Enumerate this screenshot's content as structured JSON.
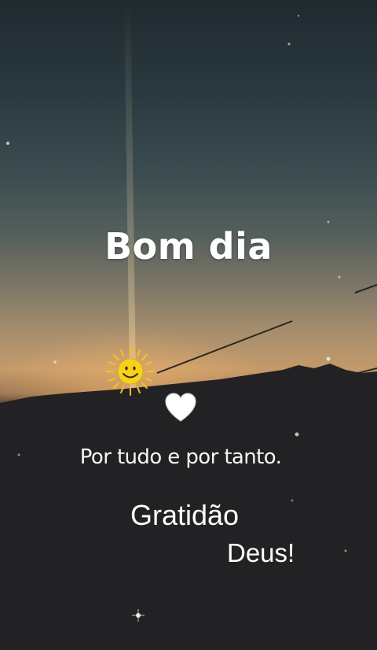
{
  "greeting": "Bom dia",
  "stickers": {
    "sun": "smiling-sun-icon",
    "heart": "white-heart-icon"
  },
  "message": {
    "line1": "Por tudo e por tanto.",
    "line2": "Gratidão",
    "line3": "Deus!"
  },
  "colors": {
    "text": "#ffffff",
    "sun": "#f5c518",
    "heart": "#ffffff"
  }
}
